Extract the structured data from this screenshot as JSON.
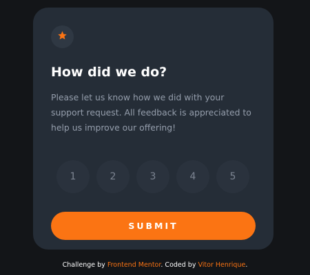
{
  "card": {
    "icon": "star-icon",
    "title": "How did we do?",
    "description": "Please let us know how we did with your support request. All feedback is appreciated to help us improve our offering!",
    "ratings": [
      "1",
      "2",
      "3",
      "4",
      "5"
    ],
    "submit_label": "SUBMIT"
  },
  "attribution": {
    "prefix": "Challenge by ",
    "link1": "Frontend Mentor",
    "middle": ". Coded by ",
    "link2": "Vitor Henrique",
    "suffix": "."
  },
  "colors": {
    "background": "#131518",
    "card": "#252d37",
    "accent": "#fb7413",
    "muted_text": "#959eac"
  }
}
